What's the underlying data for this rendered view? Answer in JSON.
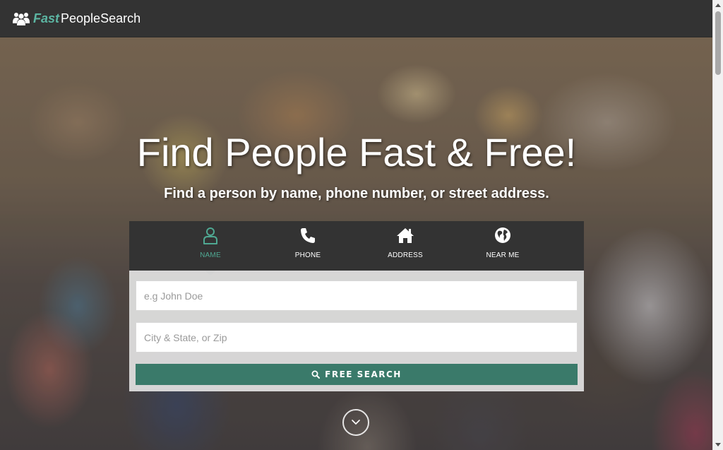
{
  "navbar": {
    "logo_fast": "Fast",
    "logo_rest": "PeopleSearch"
  },
  "hero": {
    "headline": "Find People Fast & Free!",
    "subhead": "Find a person by name, phone number, or street address."
  },
  "search": {
    "tabs": [
      {
        "label": "NAME",
        "icon": "person-icon",
        "active": true
      },
      {
        "label": "PHONE",
        "icon": "phone-icon",
        "active": false
      },
      {
        "label": "ADDRESS",
        "icon": "house-icon",
        "active": false
      },
      {
        "label": "NEAR ME",
        "icon": "globe-icon",
        "active": false
      }
    ],
    "name_placeholder": "e.g John Doe",
    "location_placeholder": "City & State, or Zip",
    "button_label": "FREE SEARCH"
  },
  "colors": {
    "accent": "#4fa892",
    "button": "#3a7a6a",
    "navbar": "#333333"
  }
}
